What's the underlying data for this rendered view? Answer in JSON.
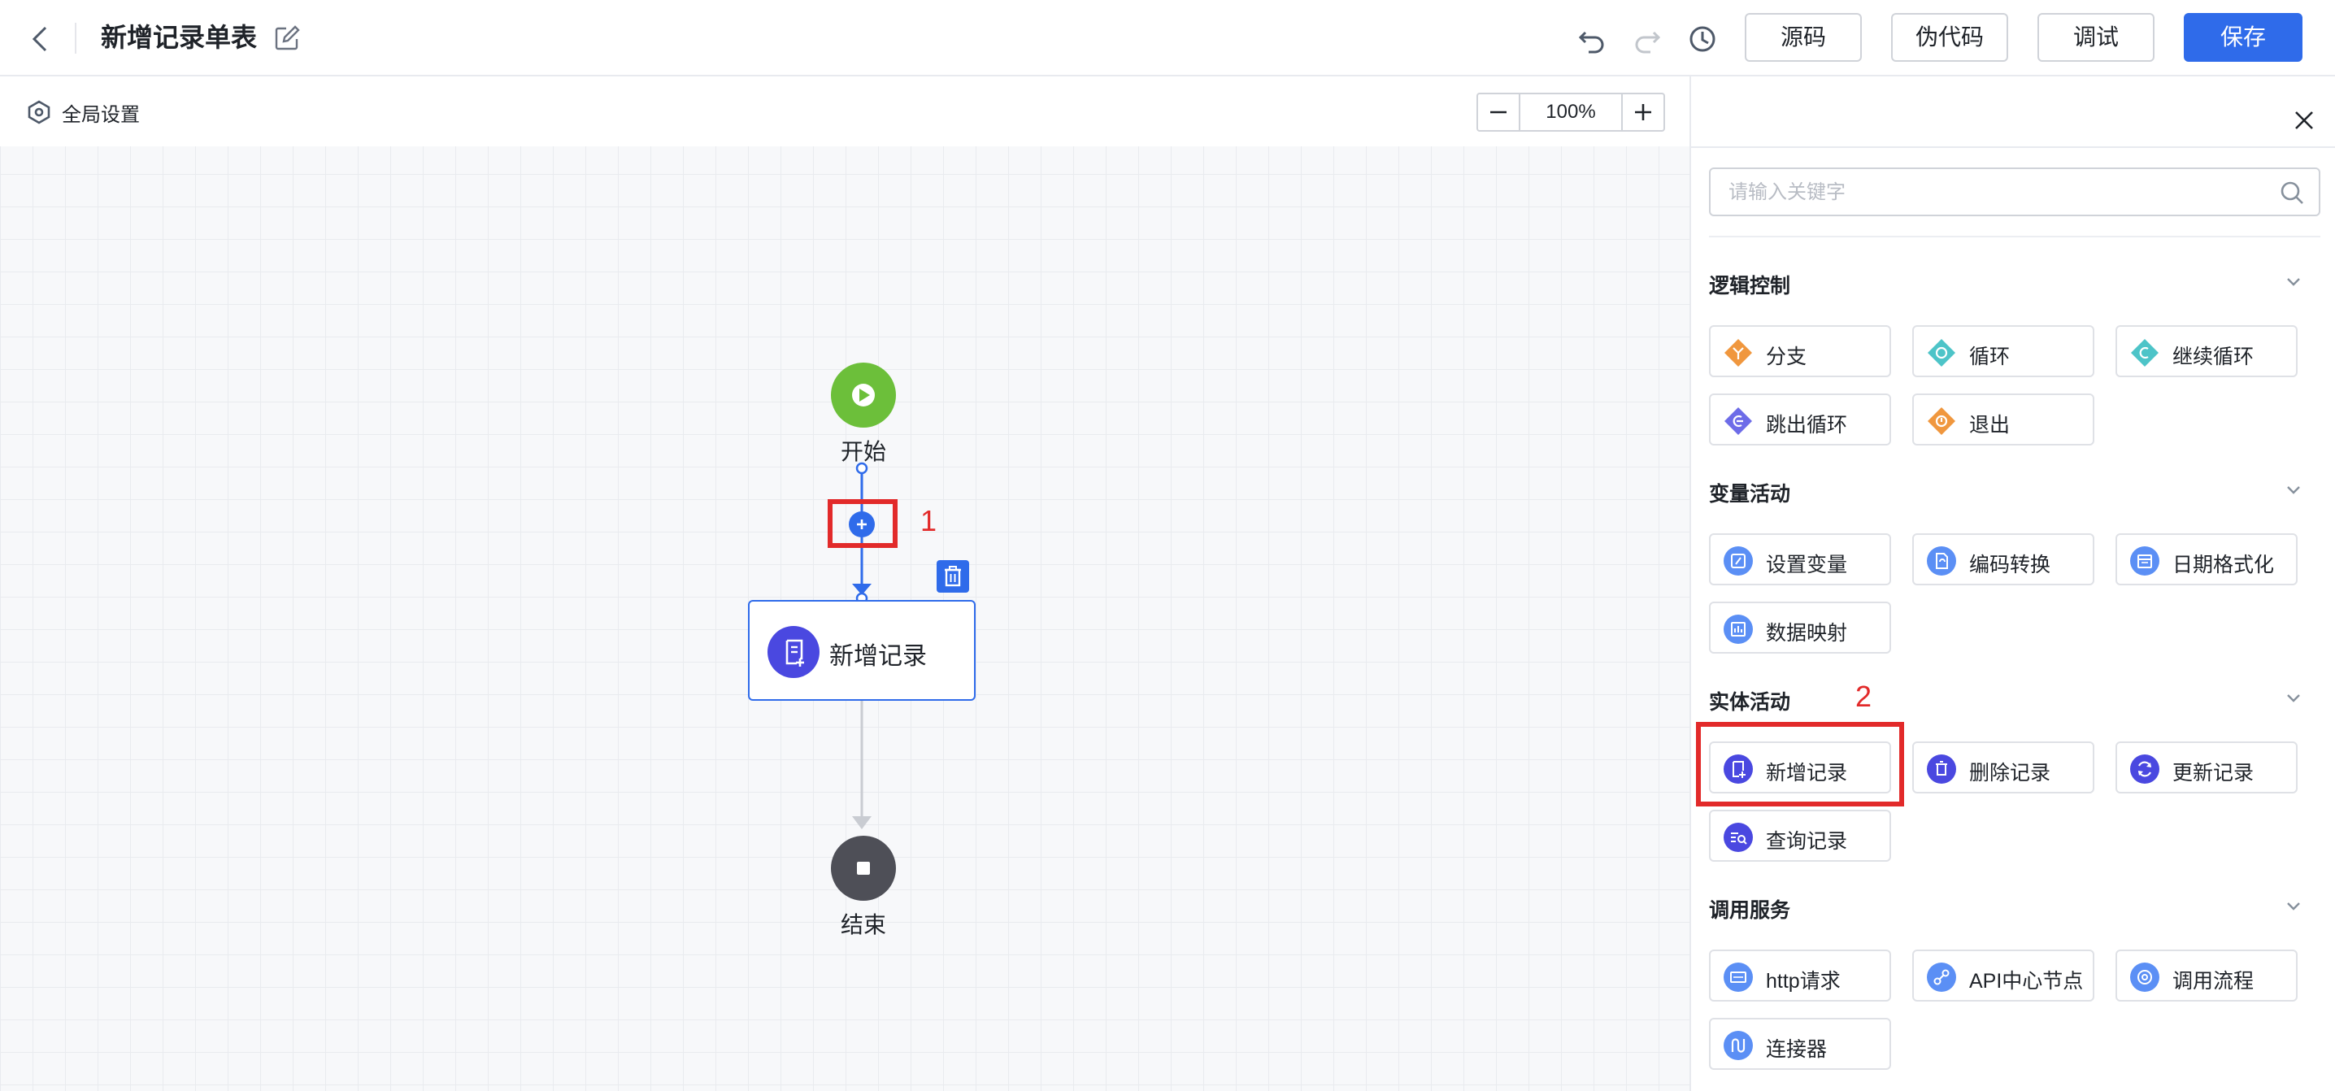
{
  "header": {
    "title": "新增记录单表",
    "buttons": {
      "source": "源码",
      "pseudo": "伪代码",
      "debug": "调试",
      "save": "保存"
    }
  },
  "canvas": {
    "global_settings": "全局设置",
    "zoom": "100%",
    "start_label": "开始",
    "end_label": "结束",
    "record_node_label": "新增记录",
    "annotations": [
      "1",
      "2"
    ]
  },
  "panel": {
    "search_placeholder": "请输入关键字",
    "sections": [
      {
        "title": "逻辑控制",
        "items": [
          "分支",
          "循环",
          "继续循环",
          "跳出循环",
          "退出"
        ]
      },
      {
        "title": "变量活动",
        "items": [
          "设置变量",
          "编码转换",
          "日期格式化",
          "数据映射"
        ]
      },
      {
        "title": "实体活动",
        "items": [
          "新增记录",
          "删除记录",
          "更新记录",
          "查询记录"
        ]
      },
      {
        "title": "调用服务",
        "items": [
          "http请求",
          "API中心节点",
          "调用流程",
          "连接器"
        ]
      }
    ]
  },
  "colors": {
    "primary": "#2f6bea",
    "highlight": "#e22a2a",
    "start": "#6cbf3a",
    "end": "#4e4f57",
    "entity": "#4a48e0",
    "logic_orange": "#f0973e",
    "logic_teal": "#4dc4c8",
    "logic_purple": "#6d6ce8",
    "variable_blue": "#5b8ff5"
  }
}
